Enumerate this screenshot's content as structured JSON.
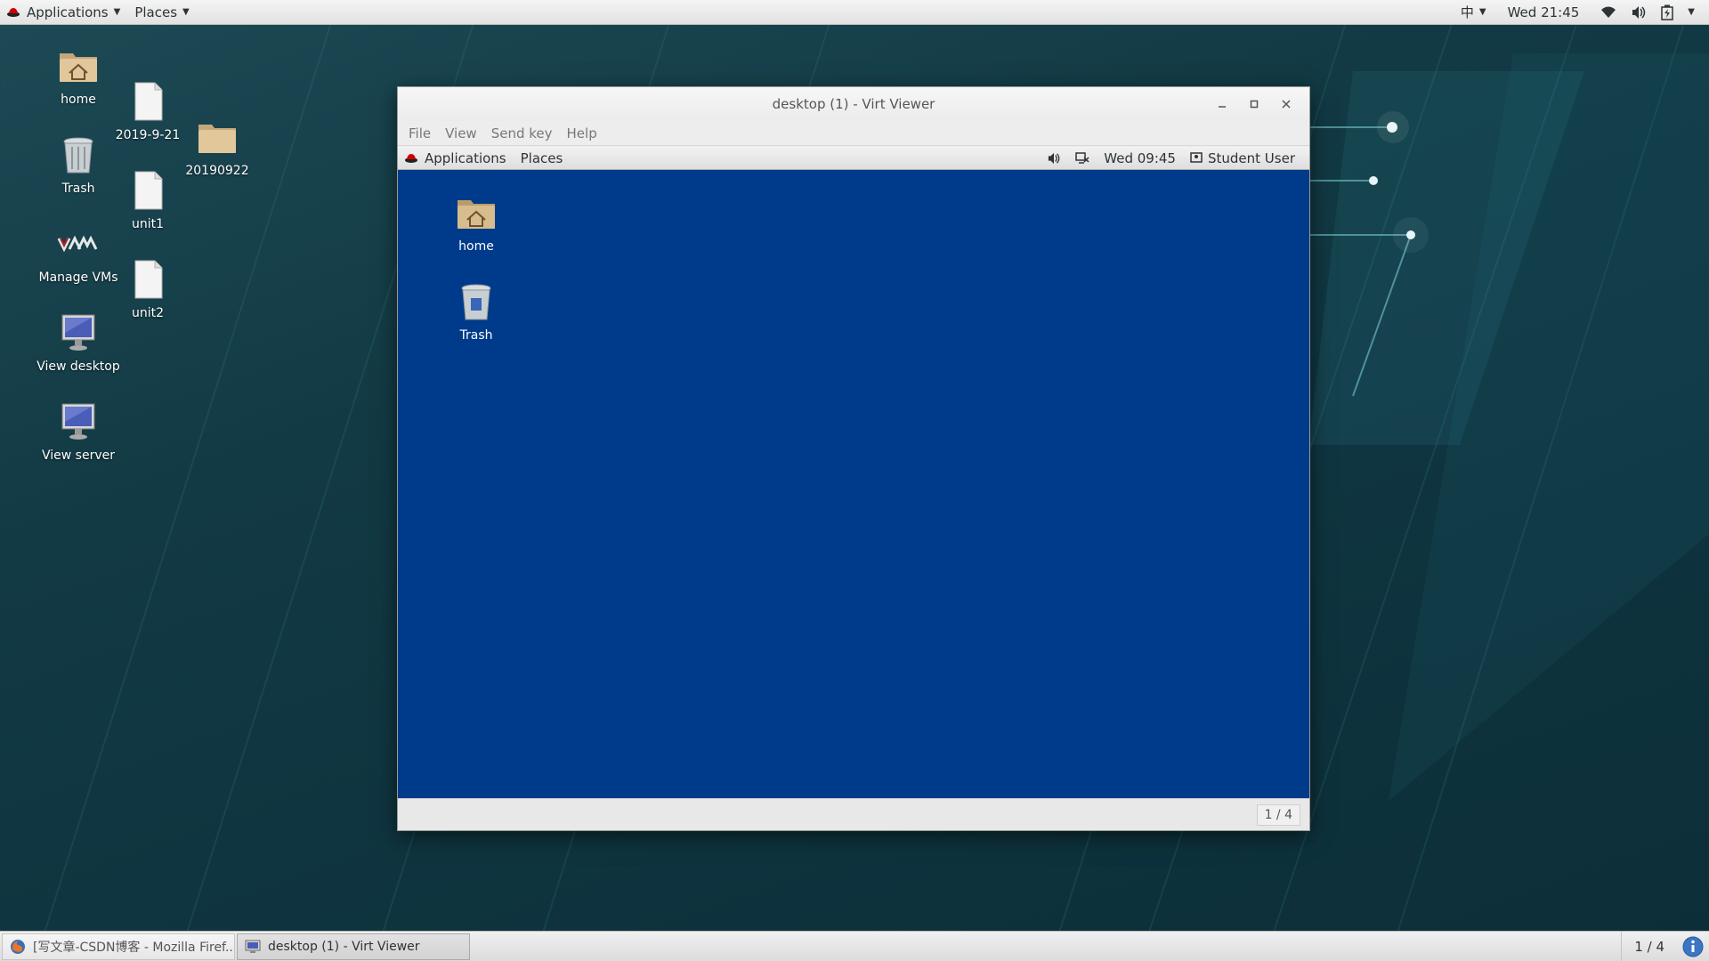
{
  "top_panel": {
    "applications_label": "Applications",
    "places_label": "Places",
    "input_method": "中",
    "clock": "Wed 21:45"
  },
  "desktop_icons": [
    {
      "label": "home",
      "icon": "home-folder-icon"
    },
    {
      "label": "Trash",
      "icon": "trash-icon"
    },
    {
      "label": "Manage VMs",
      "icon": "virt-manager-icon"
    },
    {
      "label": "View desktop",
      "icon": "monitor-icon"
    },
    {
      "label": "View server",
      "icon": "monitor-icon"
    },
    {
      "label": "2019-9-21",
      "icon": "document-icon"
    },
    {
      "label": "unit1",
      "icon": "document-icon"
    },
    {
      "label": "unit2",
      "icon": "document-icon"
    },
    {
      "label": "20190922",
      "icon": "folder-icon"
    }
  ],
  "viewer_window": {
    "title": "desktop (1) - Virt Viewer",
    "menu": [
      "File",
      "View",
      "Send key",
      "Help"
    ],
    "guest_panel": {
      "applications_label": "Applications",
      "places_label": "Places",
      "clock": "Wed 09:45",
      "user": "Student User"
    },
    "guest_icons": [
      {
        "label": "home",
        "icon": "home-folder-icon"
      },
      {
        "label": "Trash",
        "icon": "trash-icon"
      }
    ],
    "workspace": "1 / 4"
  },
  "taskbar": {
    "tasks": [
      {
        "label": "[写文章-CSDN博客 - Mozilla Firef...",
        "icon": "firefox-icon",
        "active": false
      },
      {
        "label": "desktop (1) - Virt Viewer",
        "icon": "virt-viewer-icon",
        "active": true
      }
    ],
    "workspace": "1 / 4"
  },
  "colors": {
    "guest_background": "#003a8a",
    "desktop_background": "#123a44"
  }
}
